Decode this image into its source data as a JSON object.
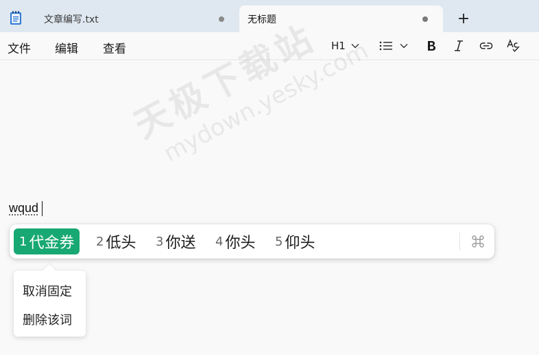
{
  "tabs": [
    {
      "label": "文章编写.txt",
      "active": false
    },
    {
      "label": "无标题",
      "active": true
    }
  ],
  "new_tab_label": "+",
  "menu": [
    "文件",
    "编辑",
    "查看"
  ],
  "toolbar": {
    "heading_label": "H1",
    "icons": [
      "heading-dropdown",
      "list-icon",
      "bold-icon",
      "italic-icon",
      "link-icon",
      "spellcheck-icon"
    ]
  },
  "watermark": {
    "cn": "天极下载站",
    "en": "mydown.yesky.com"
  },
  "editor": {
    "text": "wqud"
  },
  "ime": {
    "accent": "#18a873",
    "candidates": [
      {
        "num": "1",
        "text": "代金券",
        "selected": true
      },
      {
        "num": "2",
        "text": "低头",
        "selected": false
      },
      {
        "num": "3",
        "text": "你送",
        "selected": false
      },
      {
        "num": "4",
        "text": "你头",
        "selected": false
      },
      {
        "num": "5",
        "text": "仰头",
        "selected": false
      }
    ]
  },
  "popup": {
    "items": [
      "取消固定",
      "删除该词"
    ]
  }
}
